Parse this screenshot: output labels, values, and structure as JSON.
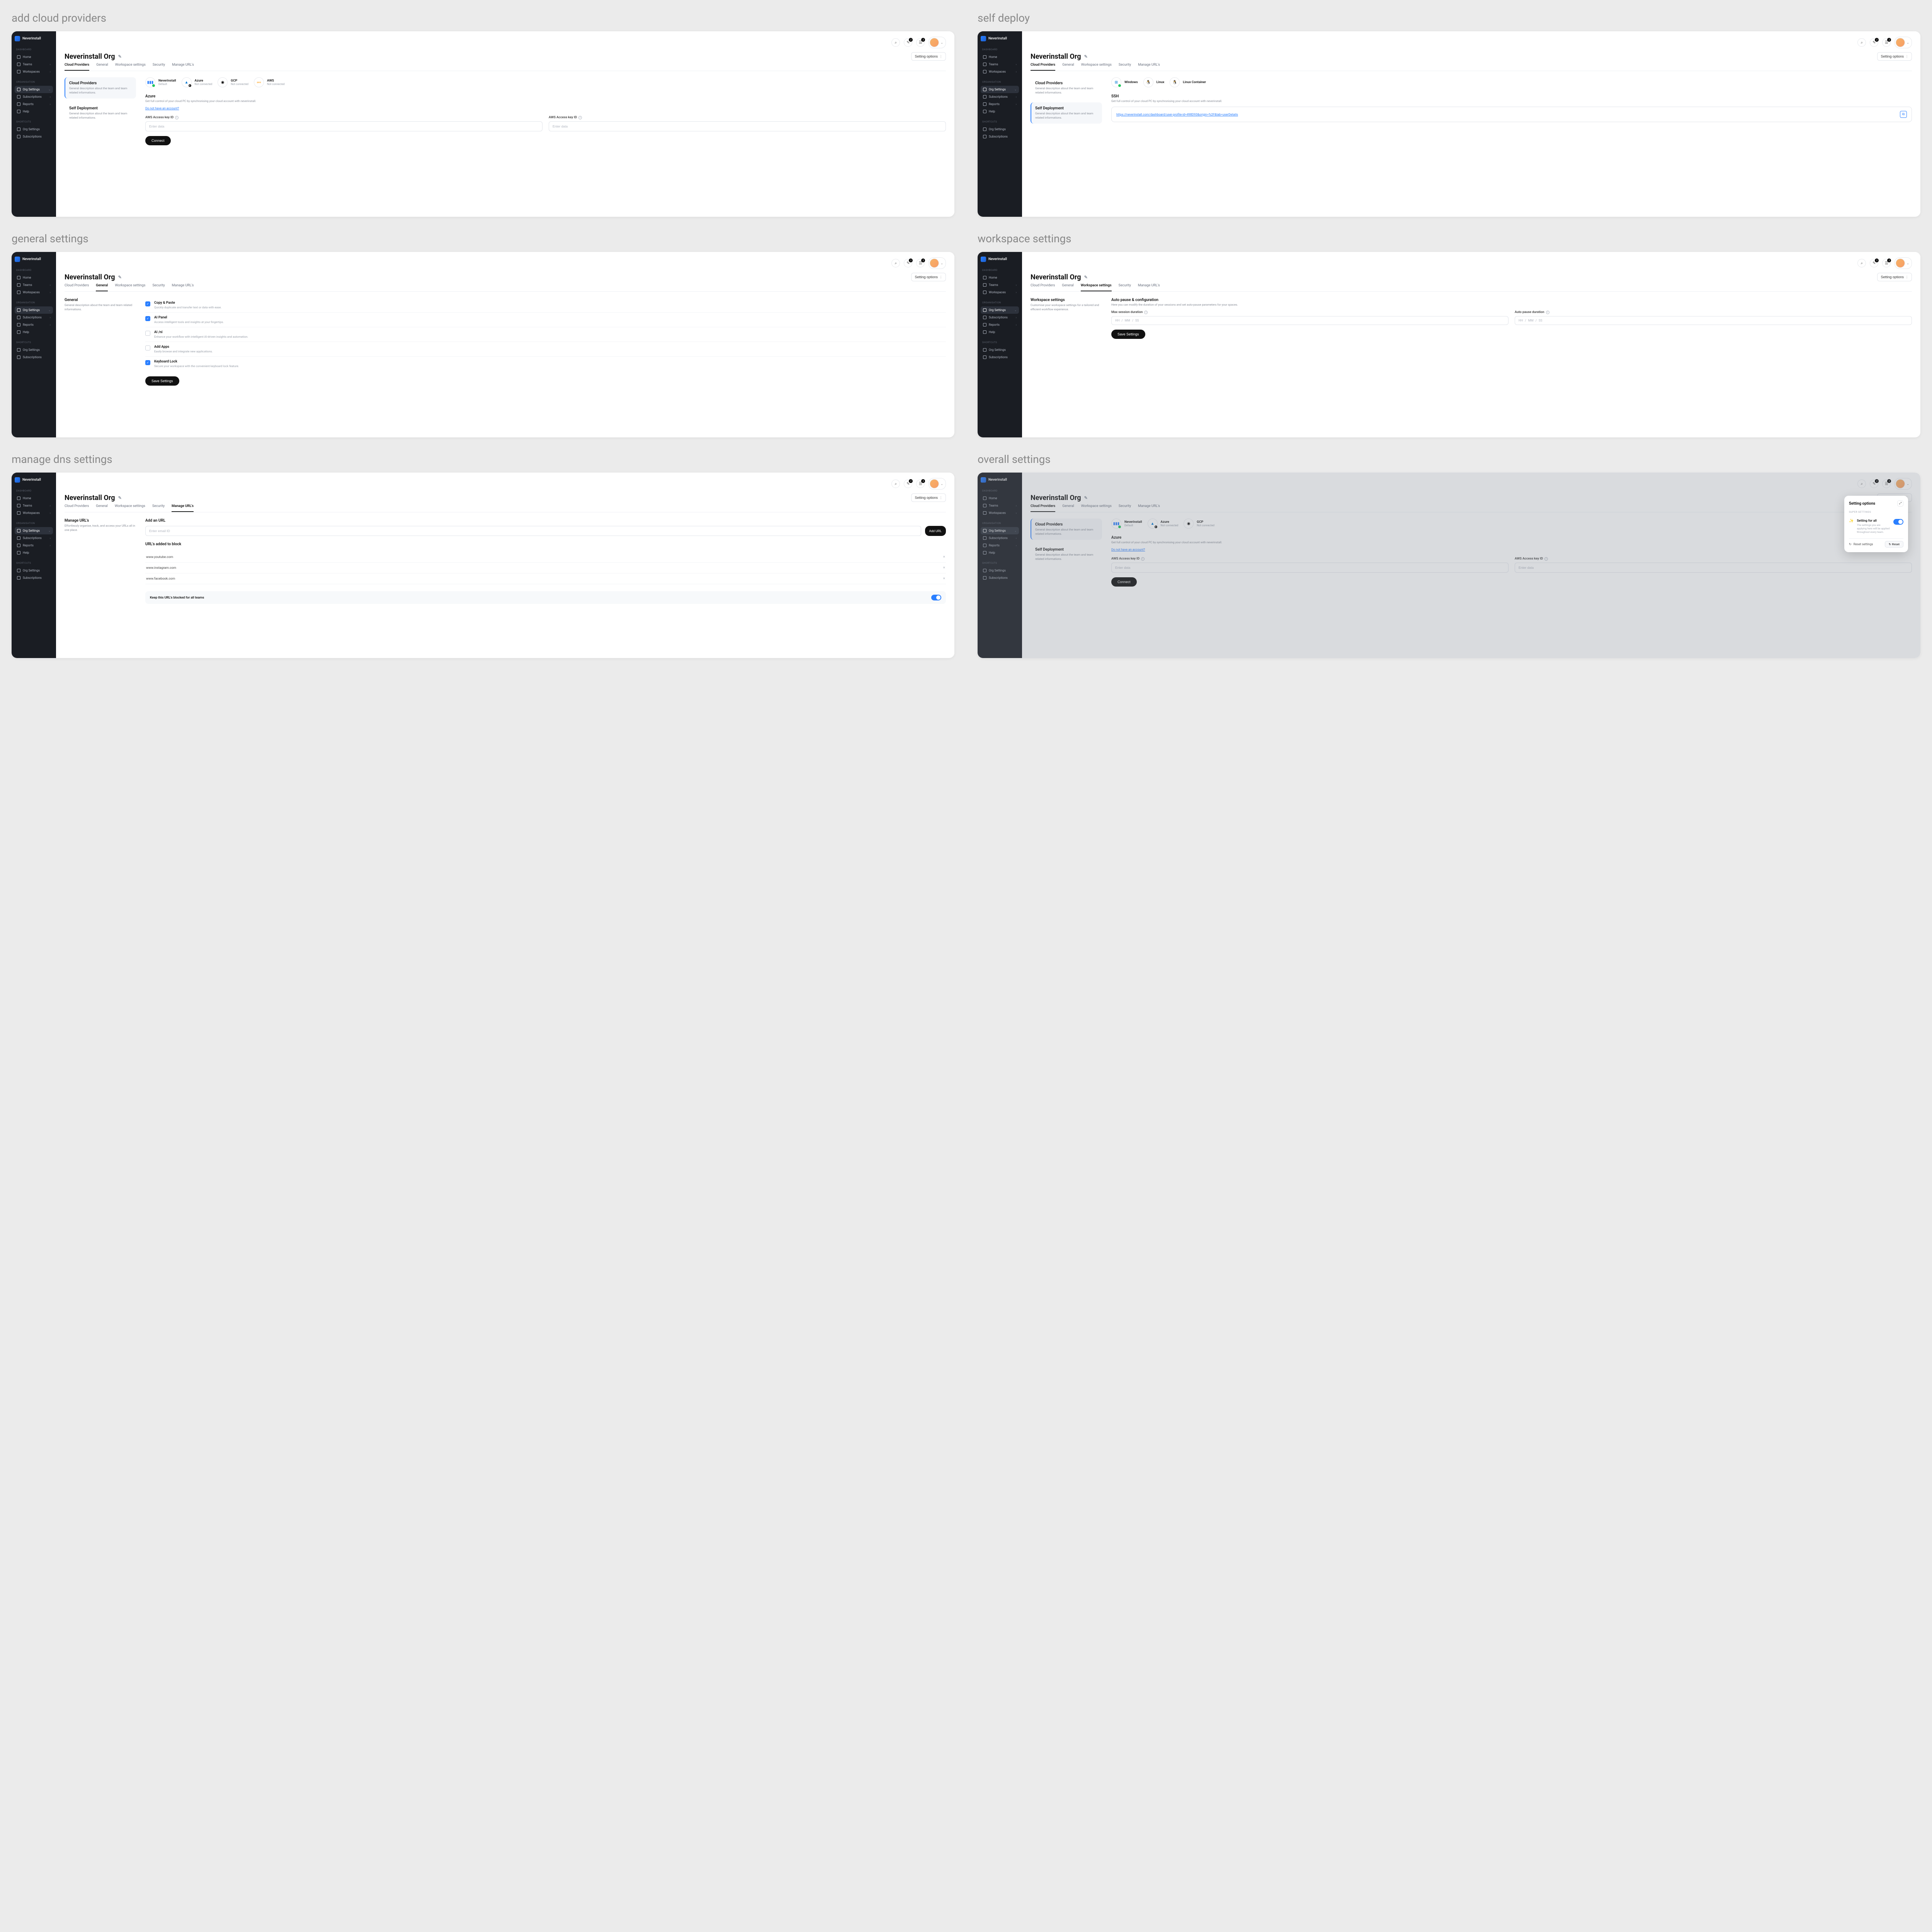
{
  "brand": "Neverinstall",
  "org_title": "Neverinstall Org",
  "settings_btn": "Setting options",
  "nav": {
    "labels": {
      "dashboard": "DASHBOARD",
      "organisation": "ORGANISATION",
      "shortcuts": "SHORTCUTS"
    },
    "items": {
      "home": "Home",
      "teams": "Teams",
      "workspaces": "Workspaces",
      "org_settings": "Org Settings",
      "subscriptions": "Subscriptions",
      "reports": "Reports",
      "help": "Help",
      "sc_org": "Org Settings",
      "sc_sub": "Subscriptions"
    }
  },
  "tabs": {
    "cloud": "Cloud Providers",
    "general": "General",
    "workspace": "Workspace settings",
    "security": "Security",
    "urls": "Manage URL's"
  },
  "screens": {
    "addcloud_title": "add cloud providers",
    "selfdeploy_title": "self deploy",
    "general_title": "general settings",
    "workspace_title": "workspace settings",
    "dns_title": "manage dns settings",
    "overall_title": "overall settings"
  },
  "left": {
    "cloud_providers": {
      "title": "Cloud Providers",
      "desc": "General description about the team and team related informations."
    },
    "self_deployment": {
      "title": "Self Deployment",
      "desc": "General description about the team and team related informations."
    },
    "general": {
      "title": "General",
      "desc": "General description about the team and team related informations."
    },
    "workspace": {
      "title": "Workspace settings",
      "desc": "Customise your workspace settings for a tailored and efficient workflow experience."
    },
    "urls": {
      "title": "Manage URL's",
      "desc": "Effortlessly organise, track, and access your URLs all in one place."
    }
  },
  "providers": {
    "neverinstall": {
      "name": "Neverinstall",
      "status": "Default"
    },
    "azure": {
      "name": "Azure",
      "status": "Not connected"
    },
    "gcp": {
      "name": "GCP",
      "status": "Not connected"
    },
    "aws": {
      "name": "AWS",
      "status": "Not connected"
    },
    "windows": {
      "name": "Windows",
      "status": ""
    },
    "linux": {
      "name": "Linux",
      "status": ""
    },
    "linuxc": {
      "name": "Linux Container",
      "status": ""
    }
  },
  "azure_form": {
    "title": "Azure",
    "sub": "Get full control of your cloud PC by synchronising your cloud account with neverinstall.",
    "no_account": "Do not have an account?",
    "key_label": "AWS Access key ID",
    "placeholder": "Enter data",
    "connect": "Connect"
  },
  "ssh": {
    "title": "SSH",
    "sub": "Get full control of your cloud PC by synchronising your cloud account with neverinstall.",
    "url": "https://neverinstall.com/dashboard/user-profile-id=498D93&origin=%2F&tab=userDetails"
  },
  "general_checks": [
    {
      "checked": true,
      "title": "Copy & Paste",
      "desc": "Quickly duplicate and transfer text or data with ease."
    },
    {
      "checked": true,
      "title": "AI Panel",
      "desc": "Access intelligent tools and insights at your fingertips."
    },
    {
      "checked": false,
      "title": "AI /ni",
      "desc": "Enhance your workflow with intelligent AI-driven insights and automation."
    },
    {
      "checked": false,
      "title": "Add Apps",
      "desc": "Easily browse and integrate new applications."
    },
    {
      "checked": true,
      "title": "Keyboard Lock",
      "desc": "Secure your workspace with the convenient keyboard lock feature."
    }
  ],
  "save_btn": "Save Settings",
  "workspace_panel": {
    "title": "Auto pause & configuration",
    "sub": "Here you can modify the duration of your sessions and set auto-pause parameters for your spaces.",
    "max_label": "Max session duration",
    "auto_label": "Auto pause duration",
    "hh": "HH",
    "mm": "MM",
    "ss": "SS"
  },
  "urls_panel": {
    "add_title": "Add an URL",
    "placeholder": "Enter email ID",
    "add_btn": "Add URL",
    "list_title": "URL's added to block",
    "items": [
      "www.youtube.com",
      "www.instagram.com",
      "www.facebook.com"
    ],
    "keep_all": "Keep this URL's blocked for all teams"
  },
  "popover": {
    "title": "Setting options",
    "section": "SUPER SETTINGS",
    "row_title": "Setting for all",
    "row_desc": "The settings you are applying here will be applied throughout every team.",
    "reset_label": "Reset settings",
    "reset_btn": "Reset"
  }
}
